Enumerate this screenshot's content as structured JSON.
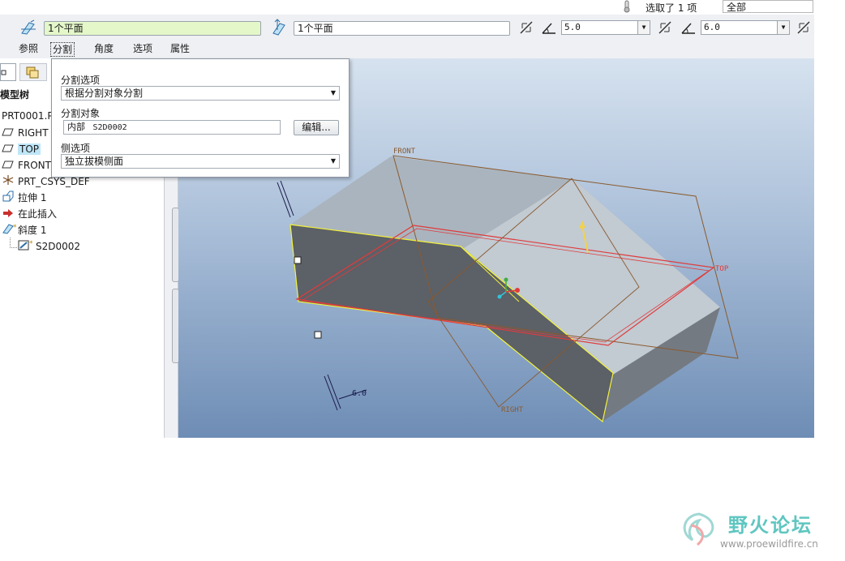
{
  "status": {
    "selected_text": "选取了 1 项",
    "filter_value": "全部"
  },
  "dashboard": {
    "ref1_value": "1个平面",
    "ref2_value": "1个平面",
    "angle1_value": "5.0",
    "angle2_value": "6.0",
    "tabs": [
      {
        "label": "参照"
      },
      {
        "label": "分割"
      },
      {
        "label": "角度"
      },
      {
        "label": "选项"
      },
      {
        "label": "属性"
      }
    ]
  },
  "split_panel": {
    "split_options_label": "分割选项",
    "split_options_value": "根据分割对象分割",
    "split_object_label": "分割对象",
    "split_object_type": "内部",
    "split_object_value": "S2D0002",
    "edit_button": "编辑...",
    "side_options_label": "侧选项",
    "side_options_value": "独立拔模侧面"
  },
  "tree": {
    "header": "模型树",
    "items": [
      {
        "label": "PRT0001.P"
      },
      {
        "label": "RIGHT"
      },
      {
        "label": "TOP"
      },
      {
        "label": "FRONT"
      },
      {
        "label": "PRT_CSYS_DEF"
      },
      {
        "label": "拉伸 1"
      },
      {
        "label": "在此插入"
      },
      {
        "label": "斜度 1"
      },
      {
        "label": "S2D0002"
      }
    ]
  },
  "graphics": {
    "label_front": "FRONT",
    "label_top": "TOP",
    "label_right": "RIGHT",
    "dim_value": "6.0"
  },
  "watermark": {
    "title": "野火论坛",
    "url": "www.proewildfire.cn"
  },
  "colors": {
    "datum_brown": "#8a5a2e",
    "highlight_red": "#e03b3b",
    "selection_yellow": "#f2f23a",
    "watermark_teal": "#5fc6c0"
  }
}
